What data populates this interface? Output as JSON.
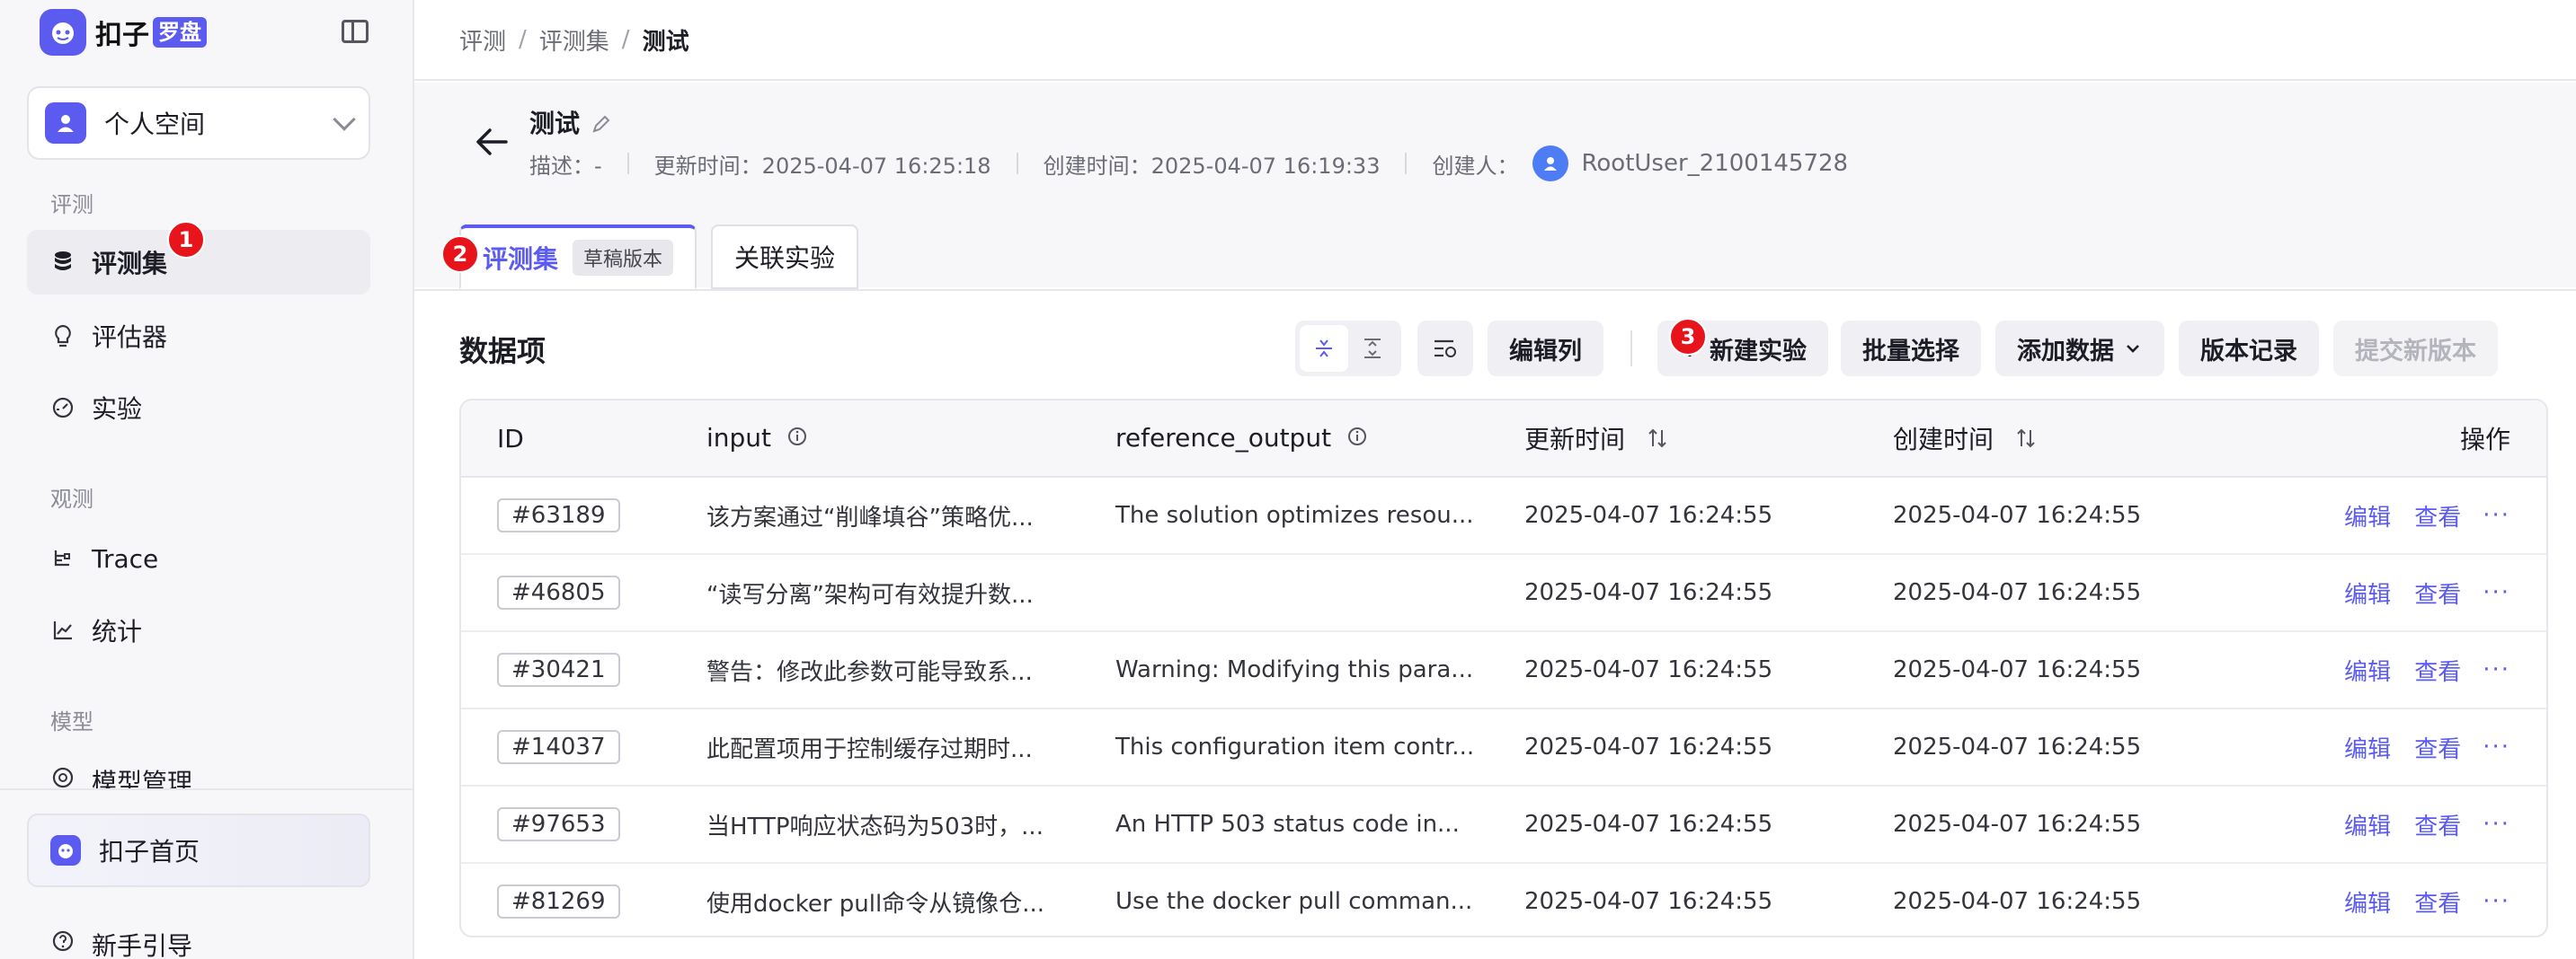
{
  "sidebar": {
    "brand_name": "扣子",
    "brand_tag": "罗盘",
    "space_label": "个人空间",
    "sections": [
      {
        "label": "评测"
      },
      {
        "label": "观测"
      },
      {
        "label": "模型"
      }
    ],
    "items": [
      {
        "label": "评测集"
      },
      {
        "label": "评估器"
      },
      {
        "label": "实验"
      },
      {
        "label": "Trace"
      },
      {
        "label": "统计"
      },
      {
        "label": "模型管理"
      }
    ],
    "home_label": "扣子首页",
    "guide_label": "新手引导"
  },
  "badges": {
    "one": "1",
    "two": "2",
    "three": "3"
  },
  "breadcrumb": [
    "评测",
    "评测集",
    "测试"
  ],
  "header": {
    "title": "测试",
    "description": "描述：-",
    "updated": "更新时间：2025-04-07 16:25:18",
    "created": "创建时间：2025-04-07 16:19:33",
    "creator_label": "创建人：",
    "creator": "RootUser_2100145728"
  },
  "tabs": [
    {
      "label": "评测集",
      "tag": "草稿版本"
    },
    {
      "label": "关联实验"
    }
  ],
  "section_title": "数据项",
  "toolbar": {
    "edit_columns": "编辑列",
    "new_experiment": "新建实验",
    "batch_select": "批量选择",
    "add_data": "添加数据",
    "version_history": "版本记录",
    "submit_version": "提交新版本"
  },
  "table": {
    "headers": [
      "ID",
      "input",
      "reference_output",
      "更新时间",
      "创建时间",
      "操作"
    ],
    "row_actions": {
      "edit": "编辑",
      "view": "查看",
      "more": "···"
    },
    "rows": [
      {
        "id": "#63189",
        "input": "该方案通过“削峰填谷”策略优...",
        "ref": "The solution optimizes resou...",
        "updated": "2025-04-07 16:24:55",
        "created": "2025-04-07 16:24:55"
      },
      {
        "id": "#46805",
        "input": "“读写分离”架构可有效提升数...",
        "ref": "",
        "updated": "2025-04-07 16:24:55",
        "created": "2025-04-07 16:24:55"
      },
      {
        "id": "#30421",
        "input": "警告：修改此参数可能导致系...",
        "ref": "Warning: Modifying this para...",
        "updated": "2025-04-07 16:24:55",
        "created": "2025-04-07 16:24:55"
      },
      {
        "id": "#14037",
        "input": "此配置项用于控制缓存过期时...",
        "ref": "This configuration item contr...",
        "updated": "2025-04-07 16:24:55",
        "created": "2025-04-07 16:24:55"
      },
      {
        "id": "#97653",
        "input": "当HTTP响应状态码为503时，...",
        "ref": "An HTTP 503 status code in...",
        "updated": "2025-04-07 16:24:55",
        "created": "2025-04-07 16:24:55"
      },
      {
        "id": "#81269",
        "input": "使用docker pull命令从镜像仓...",
        "ref": "Use the docker pull comman...",
        "updated": "2025-04-07 16:24:55",
        "created": "2025-04-07 16:24:55"
      }
    ]
  },
  "colors": {
    "accent": "#5b5bf0",
    "badge": "#e8141c",
    "avatar": "#4d7cf5"
  }
}
